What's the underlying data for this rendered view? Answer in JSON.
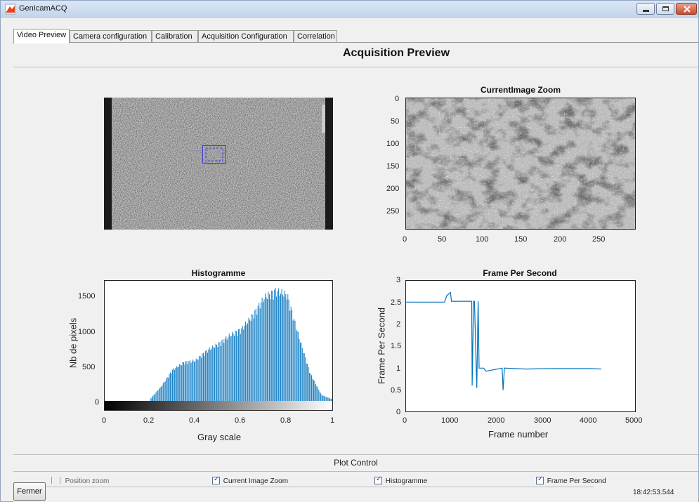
{
  "window": {
    "title": "GenIcamACQ"
  },
  "tabs": [
    {
      "label": "Video Preview",
      "active": true
    },
    {
      "label": "Camera configuration",
      "active": false
    },
    {
      "label": "Calibration",
      "active": false
    },
    {
      "label": "Acquisition Configuration",
      "active": false
    },
    {
      "label": "Correlation",
      "active": false
    }
  ],
  "main": {
    "title": "Acquisition Preview"
  },
  "zoom_plot": {
    "title": "CurrentImage Zoom",
    "y_ticks": [
      "0",
      "50",
      "100",
      "150",
      "200",
      "250"
    ],
    "x_ticks": [
      "0",
      "50",
      "100",
      "150",
      "200",
      "250"
    ]
  },
  "hist_plot": {
    "title": "Histogramme",
    "xlabel": "Gray scale",
    "ylabel": "Nb de pixels",
    "y_ticks": [
      "0",
      "500",
      "1000",
      "1500"
    ],
    "x_ticks": [
      "0",
      "0.2",
      "0.4",
      "0.6",
      "0.8",
      "1"
    ]
  },
  "fps_plot": {
    "title": "Frame Per Second",
    "xlabel": "Frame number",
    "ylabel": "Frame Per Second",
    "y_ticks": [
      "0",
      "0.5",
      "1",
      "1.5",
      "2",
      "2.5",
      "3"
    ],
    "x_ticks": [
      "0",
      "1000",
      "2000",
      "3000",
      "4000",
      "5000"
    ]
  },
  "chart_data": [
    {
      "type": "bar",
      "title": "Histogramme",
      "xlabel": "Gray scale",
      "ylabel": "Nb de pixels",
      "xlim": [
        0,
        1
      ],
      "ylim": [
        0,
        1700
      ],
      "x": [
        0.2,
        0.25,
        0.3,
        0.35,
        0.4,
        0.45,
        0.5,
        0.55,
        0.6,
        0.65,
        0.7,
        0.75,
        0.8,
        0.85,
        0.9,
        0.95,
        1.0
      ],
      "values": [
        20,
        220,
        470,
        580,
        610,
        760,
        860,
        990,
        1080,
        1290,
        1560,
        1660,
        1600,
        980,
        420,
        90,
        20
      ]
    },
    {
      "type": "line",
      "title": "Frame Per Second",
      "xlabel": "Frame number",
      "ylabel": "Frame Per Second",
      "xlim": [
        0,
        5000
      ],
      "ylim": [
        0,
        3
      ],
      "x": [
        0,
        850,
        900,
        980,
        1000,
        1440,
        1450,
        1480,
        1500,
        1550,
        1580,
        1600,
        1700,
        1750,
        2100,
        2120,
        2150,
        2600,
        3200,
        4000,
        4250
      ],
      "y": [
        2.5,
        2.5,
        2.65,
        2.72,
        2.52,
        2.52,
        0.6,
        2.52,
        2.52,
        0.55,
        2.52,
        1.0,
        1.0,
        0.93,
        1.0,
        0.5,
        1.0,
        0.98,
        0.99,
        0.99,
        0.98
      ]
    }
  ],
  "plot_control": {
    "title": "Plot Control",
    "checkboxes": [
      {
        "label": "Position zoom",
        "checked": false
      },
      {
        "label": "Current Image Zoom",
        "checked": true
      },
      {
        "label": "Histogramme",
        "checked": true
      },
      {
        "label": "Frame Per Second",
        "checked": true
      }
    ],
    "check_mark": "✓"
  },
  "footer": {
    "close_label": "Fermer",
    "time": "18:42:53.544"
  },
  "colors": {
    "plot_line": "#0072bd",
    "selection_box": "#3a3ae0"
  }
}
